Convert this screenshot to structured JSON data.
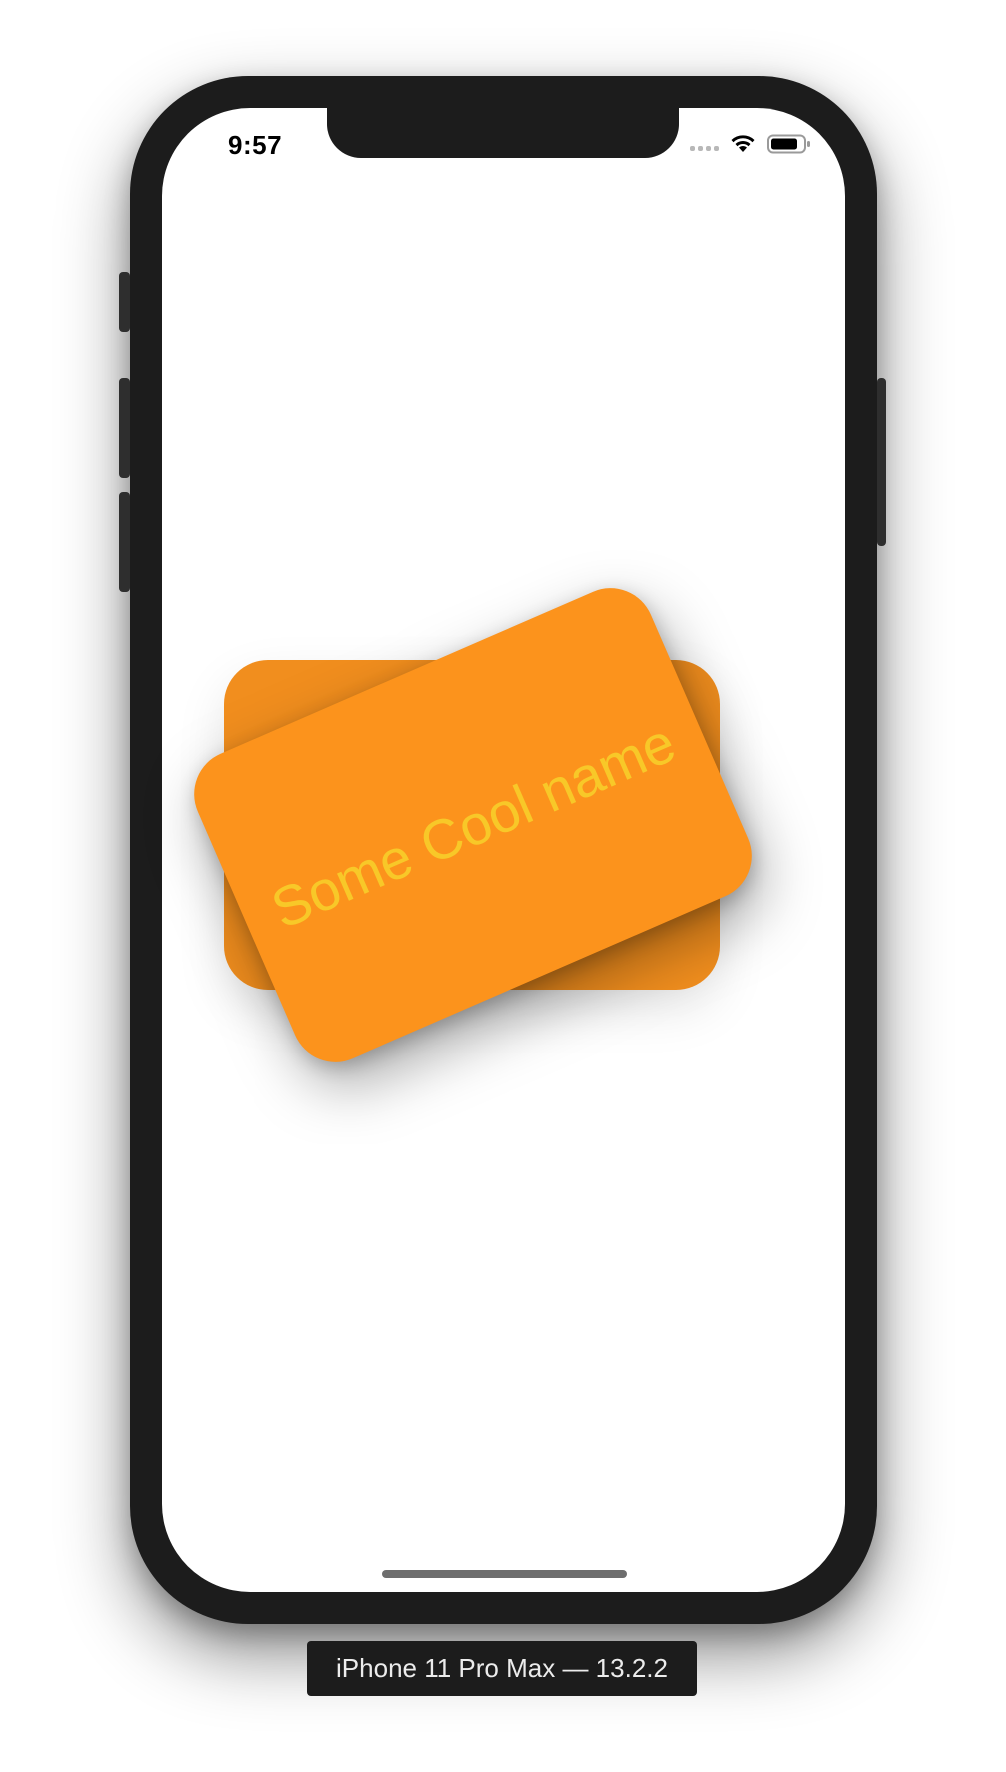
{
  "status_bar": {
    "time": "9:57",
    "icons": [
      "cellular-signal-icon",
      "wifi-icon",
      "battery-icon"
    ]
  },
  "card": {
    "name": "Some Cool name",
    "colors": {
      "front": "#fc931c",
      "back": "#f18e1e",
      "text": "#f8c828"
    }
  },
  "device_label": "iPhone 11 Pro Max — 13.2.2"
}
